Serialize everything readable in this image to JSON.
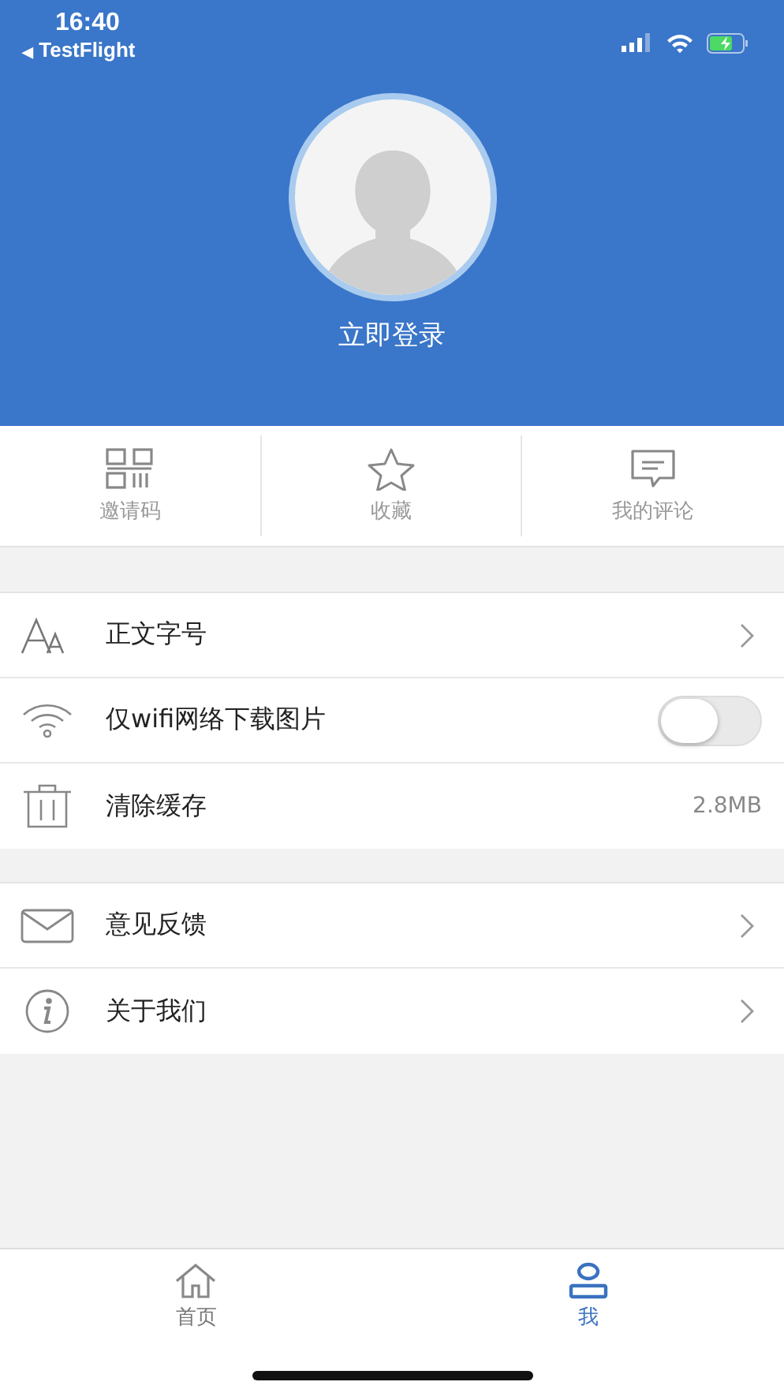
{
  "status_bar": {
    "time": "16:40",
    "back_arrow": "◀",
    "back_label": "TestFlight"
  },
  "profile": {
    "login_label": "立即登录"
  },
  "quick_actions": [
    {
      "label": "邀请码"
    },
    {
      "label": "收藏"
    },
    {
      "label": "我的评论"
    }
  ],
  "settings_groups": [
    [
      {
        "kind": "link",
        "label": "正文字号"
      },
      {
        "kind": "toggle",
        "label": "仅wifi网络下载图片",
        "on": false
      },
      {
        "kind": "value",
        "label": "清除缓存",
        "value": "2.8MB"
      }
    ],
    [
      {
        "kind": "link",
        "label": "意见反馈"
      },
      {
        "kind": "link",
        "label": "关于我们"
      }
    ]
  ],
  "tab_bar": [
    {
      "label": "首页",
      "selected": false
    },
    {
      "label": "我",
      "selected": true
    }
  ]
}
